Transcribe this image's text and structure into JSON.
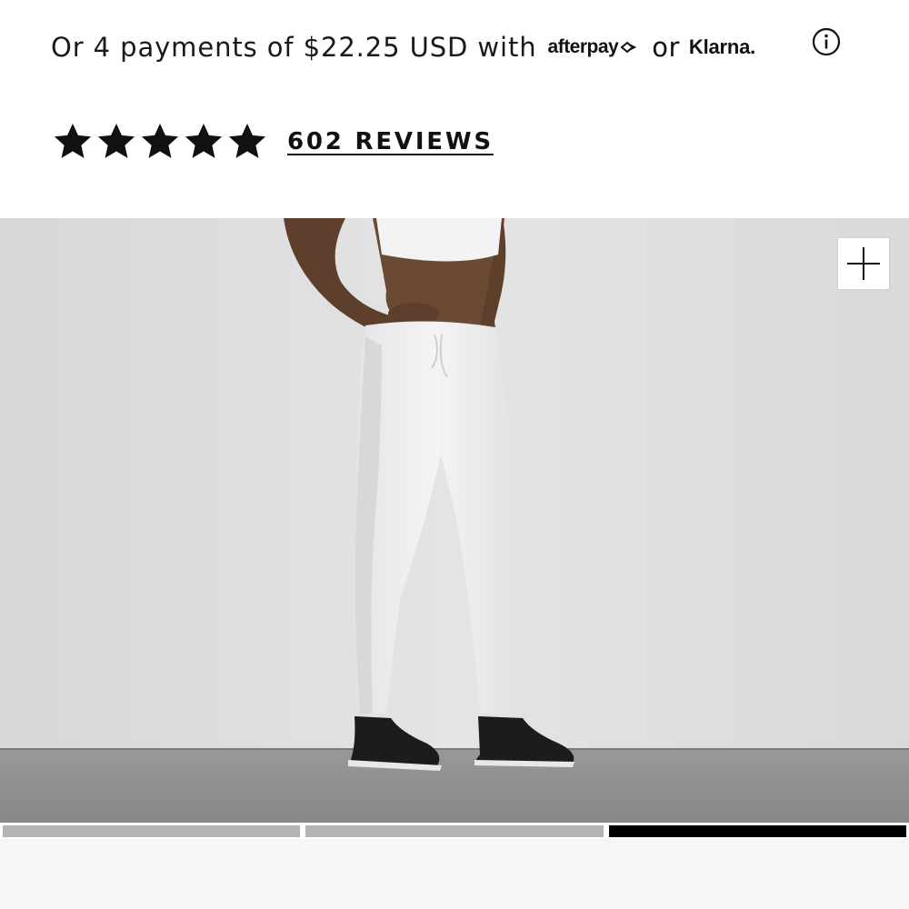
{
  "payments": {
    "text": "Or 4 payments of $22.25 USD with",
    "afterpay_logo": "afterpay",
    "or": "or",
    "klarna_logo": "Klarna.",
    "info_icon": "info-icon"
  },
  "rating": {
    "stars": 5,
    "max_stars": 5,
    "reviews_link": "602 REVIEWS"
  },
  "gallery": {
    "image_alt": "Woman wearing white camo jogger pants and black sneakers",
    "zoom_icon": "plus-icon",
    "slide_count": 3,
    "active_slide": 3
  },
  "colors": {
    "text": "#111111",
    "progress_inactive": "#b4b4b4",
    "progress_active": "#000000",
    "background": "#ffffff"
  }
}
